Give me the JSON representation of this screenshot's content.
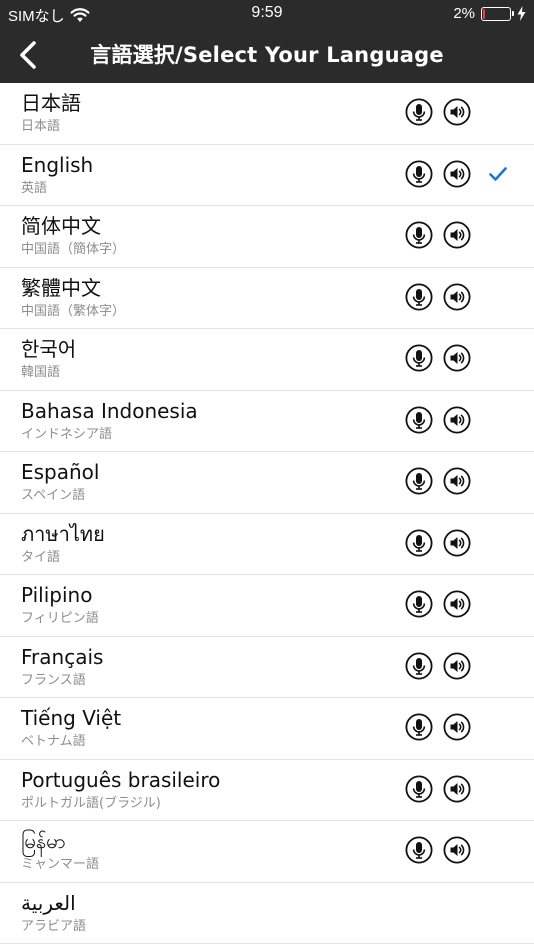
{
  "status_bar": {
    "carrier": "SIMなし",
    "time": "9:59",
    "battery_percent": "2%",
    "battery_level": 0.02
  },
  "header": {
    "title": "言語選択/Select Your Language",
    "back_icon": "chevron-left-icon"
  },
  "colors": {
    "bar": "#2b2b2b",
    "check": "#1a73e8",
    "battery_low": "#ff3b30"
  },
  "languages": [
    {
      "name": "日本語",
      "subtitle": "日本語",
      "audio": true,
      "selected": false
    },
    {
      "name": "English",
      "subtitle": "英語",
      "audio": true,
      "selected": true
    },
    {
      "name": "简体中文",
      "subtitle": "中国語（簡体字）",
      "audio": true,
      "selected": false
    },
    {
      "name": "繁體中文",
      "subtitle": "中国語（繁体字）",
      "audio": true,
      "selected": false
    },
    {
      "name": "한국어",
      "subtitle": "韓国語",
      "audio": true,
      "selected": false
    },
    {
      "name": "Bahasa Indonesia",
      "subtitle": "インドネシア語",
      "audio": true,
      "selected": false
    },
    {
      "name": "Español",
      "subtitle": "スペイン語",
      "audio": true,
      "selected": false
    },
    {
      "name": "ภาษาไทย",
      "subtitle": "タイ語",
      "audio": true,
      "selected": false
    },
    {
      "name": "Pilipino",
      "subtitle": "フィリピン語",
      "audio": true,
      "selected": false
    },
    {
      "name": "Français",
      "subtitle": "フランス語",
      "audio": true,
      "selected": false
    },
    {
      "name": "Tiếng Việt",
      "subtitle": "ベトナム語",
      "audio": true,
      "selected": false
    },
    {
      "name": "Português brasileiro",
      "subtitle": "ポルトガル語(ブラジル)",
      "audio": true,
      "selected": false
    },
    {
      "name": "မြန်မာ",
      "subtitle": "ミャンマー語",
      "audio": true,
      "selected": false
    },
    {
      "name": "العربية",
      "subtitle": "アラビア語",
      "audio": false,
      "selected": false
    }
  ]
}
